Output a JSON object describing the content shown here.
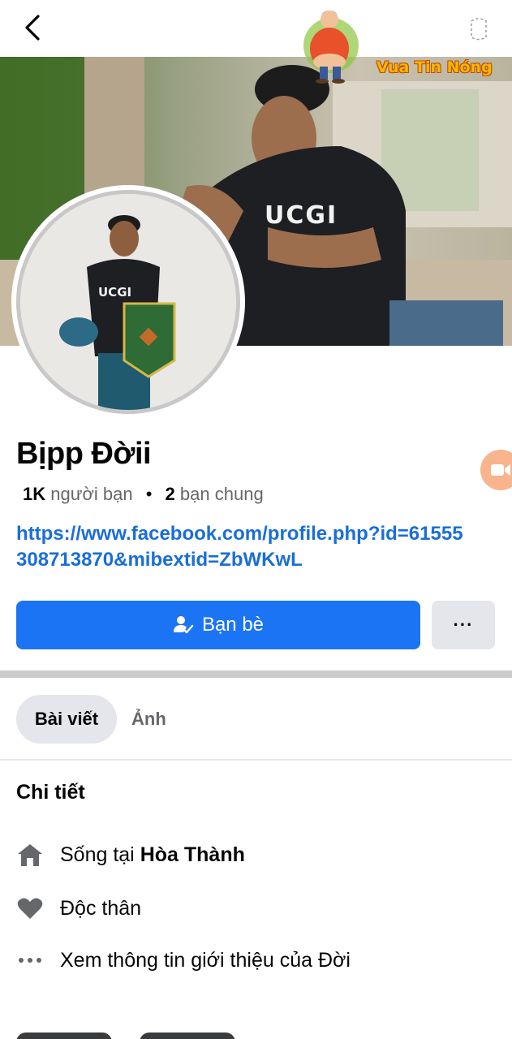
{
  "watermark": {
    "text": "Vua Tin Nóng"
  },
  "profile": {
    "name": "Bịpp Đờii",
    "friends_count": "1K",
    "friends_label": "người bạn",
    "separator": "•",
    "mutual_count": "2",
    "mutual_label": "bạn chung",
    "link": "https://www.facebook.com/profile.php?id=61555308713870&mibextid=ZbWKwL"
  },
  "actions": {
    "friends_button_label": "Bạn bè",
    "more_button_label": "···"
  },
  "tabs": [
    {
      "label": "Bài viết",
      "selected": true
    },
    {
      "label": "Ảnh",
      "selected": false
    }
  ],
  "details": {
    "heading": "Chi tiết",
    "lives_in_prefix": "Sống tại",
    "lives_in_place": "Hòa Thành",
    "relationship": "Độc thân",
    "see_about": "Xem thông tin giới thiệu của Đời"
  },
  "colors": {
    "primary": "#1b74f4",
    "link": "#1a6ed8",
    "secondary_button": "#e4e6eb",
    "video_call": "#f7b48d"
  },
  "icons": {
    "back": "chevron-left",
    "top_right": "share-icon",
    "friends": "person-check",
    "video": "video-camera",
    "home": "house",
    "heart": "heart",
    "more": "ellipsis"
  }
}
